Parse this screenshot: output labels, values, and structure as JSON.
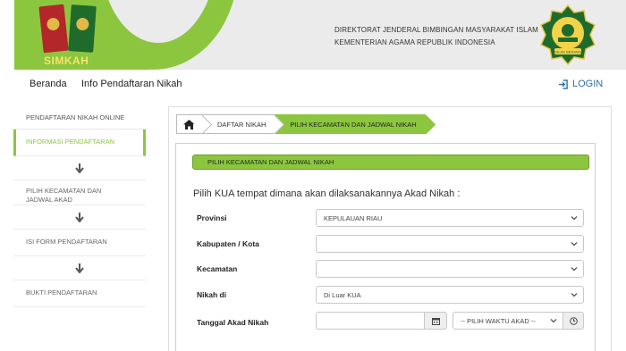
{
  "header": {
    "app_logo_text": "SIMKAH",
    "directorate": "DIREKTORAT JENDERAL BIMBINGAN MASYARAKAT ISLAM",
    "ministry": "KEMENTERIAN AGAMA REPUBLIK INDONESIA",
    "emblem_text": "IKHLAS BERAMAL",
    "brand_green": "#8cc63f"
  },
  "nav": {
    "items": [
      "Beranda",
      "Info Pendaftaran Nikah"
    ],
    "login_label": "LOGIN",
    "login_icon": "sign-in-icon"
  },
  "sidebar": {
    "heading": "PENDAFTARAN NIKAH ONLINE",
    "steps": [
      {
        "label": "INFORMASI PENDAFTARAN",
        "active": true
      },
      {
        "label": "PILIH KECAMATAN DAN JADWAL AKAD",
        "active": false
      },
      {
        "label": "ISI FORM PENDAFTARAN",
        "active": false
      },
      {
        "label": "BUKTI PENDAFTARAN",
        "active": false
      }
    ],
    "arrow_icon": "arrow-down-icon"
  },
  "breadcrumb": {
    "home_icon": "home-icon",
    "items": [
      "DAFTAR NIKAH",
      "PILIH KECAMATAN DAN JADWAL NIKAH"
    ]
  },
  "panel": {
    "title": "PILIH KECAMATAN DAN JADWAL NIKAH",
    "intro": "Pilih KUA tempat dimana akan dilaksanakannya Akad Nikah :",
    "fields": {
      "provinsi": {
        "label": "Provinsi",
        "value": "KEPULAUAN RIAU"
      },
      "kabupaten": {
        "label": "Kabupaten / Kota",
        "value": ""
      },
      "kecamatan": {
        "label": "Kecamatan",
        "value": ""
      },
      "nikah_di": {
        "label": "Nikah di",
        "value": "Di Luar KUA"
      },
      "tanggal": {
        "label": "Tanggal Akad Nikah",
        "date_value": "",
        "time_value": "-- PILIH WAKTU AKAD --"
      }
    }
  }
}
